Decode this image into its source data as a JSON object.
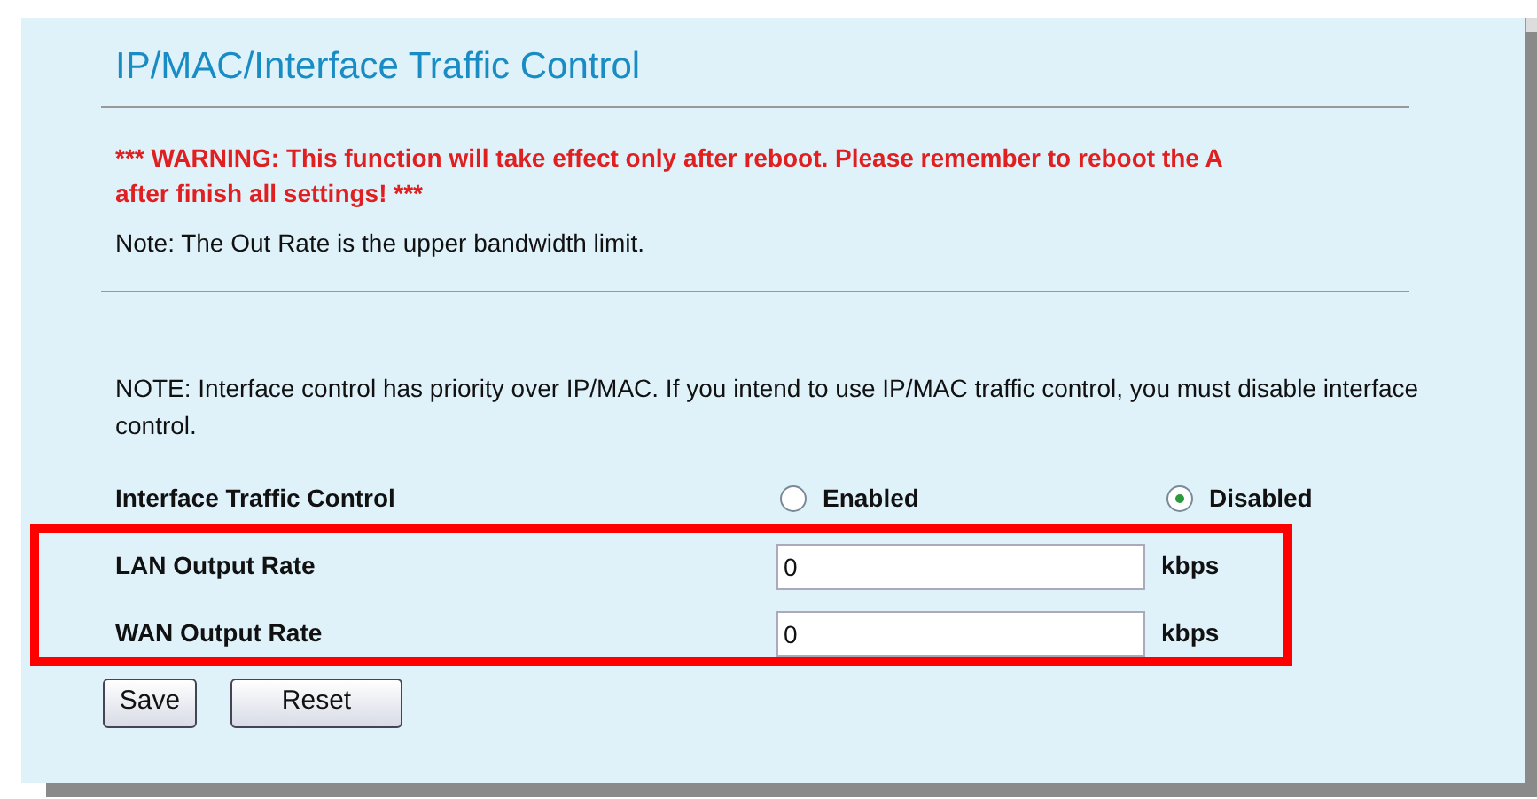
{
  "title": "IP/MAC/Interface Traffic Control",
  "warning": [
    "*** WARNING: This function will take effect only after reboot. Please remember to reboot the A",
    "after finish all settings! ***"
  ],
  "note": "Note: The Out Rate is the upper bandwidth limit.",
  "priority_note": "NOTE: Interface control has priority over IP/MAC. If you intend to use IP/MAC traffic control, you must disable interface control.",
  "interface_control": {
    "label": "Interface Traffic Control",
    "options": [
      {
        "label": "Enabled",
        "selected": false
      },
      {
        "label": "Disabled",
        "selected": true
      }
    ]
  },
  "rates": [
    {
      "label": "LAN Output Rate",
      "value": "0",
      "unit": "kbps"
    },
    {
      "label": "WAN Output Rate",
      "value": "0",
      "unit": "kbps"
    }
  ],
  "buttons": [
    "Save",
    "Reset"
  ]
}
